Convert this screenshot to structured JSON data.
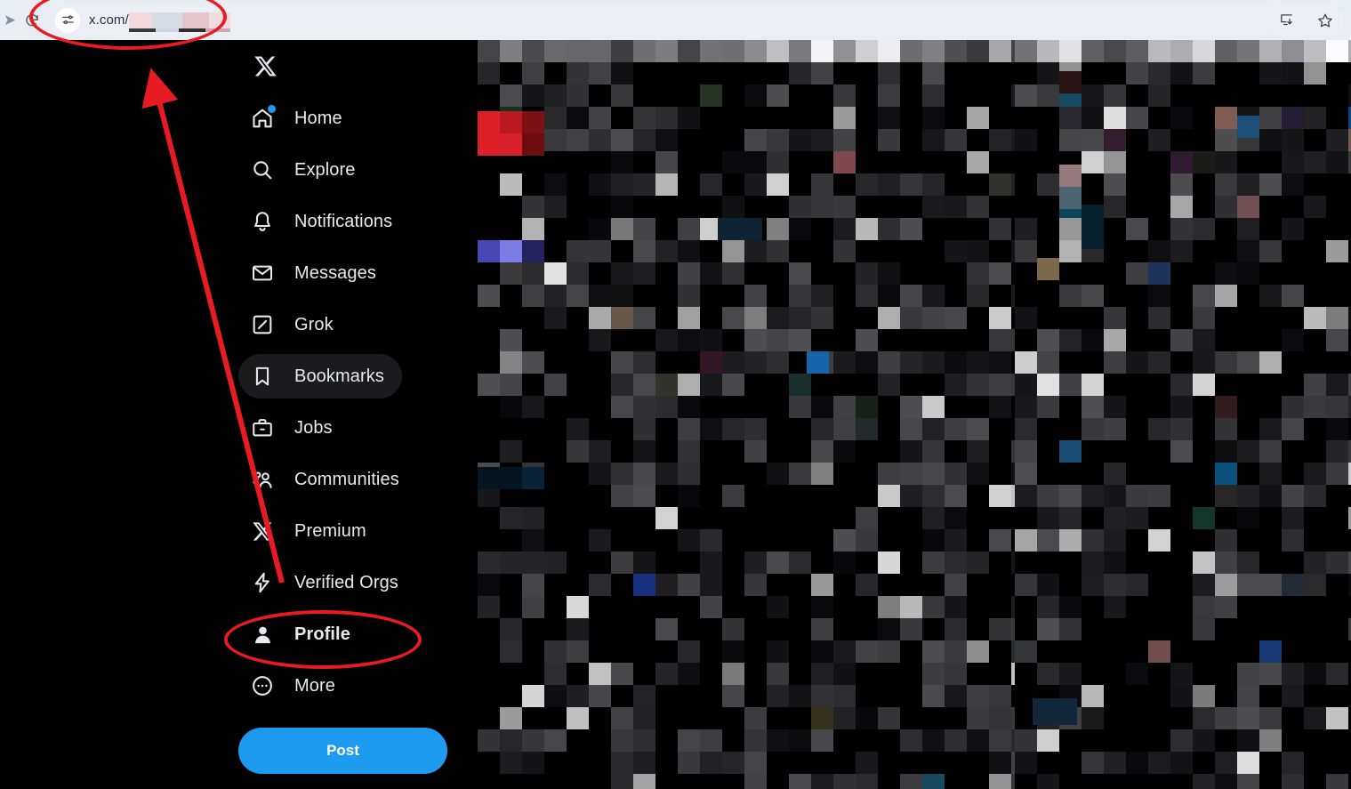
{
  "browser": {
    "forward_icon": "forward-arrow-icon",
    "reload_icon": "reload-icon",
    "site_settings_icon": "site-settings-sliders-icon",
    "url_text": "x.com/",
    "url_path_redacted": true,
    "install_app_icon": "install-app-icon",
    "bookmark_star_icon": "bookmark-star-icon"
  },
  "sidebar": {
    "logo": "x-logo-icon",
    "post_label": "Post",
    "items": [
      {
        "label": "Home",
        "icon": "home-icon",
        "badge_dot": true,
        "active": false,
        "pill": false
      },
      {
        "label": "Explore",
        "icon": "search-icon",
        "badge_dot": false,
        "active": false,
        "pill": false
      },
      {
        "label": "Notifications",
        "icon": "bell-icon",
        "badge_dot": false,
        "active": false,
        "pill": false
      },
      {
        "label": "Messages",
        "icon": "envelope-icon",
        "badge_dot": false,
        "active": false,
        "pill": false
      },
      {
        "label": "Grok",
        "icon": "grok-icon",
        "badge_dot": false,
        "active": false,
        "pill": false
      },
      {
        "label": "Bookmarks",
        "icon": "bookmark-icon",
        "badge_dot": false,
        "active": false,
        "pill": true
      },
      {
        "label": "Jobs",
        "icon": "briefcase-icon",
        "badge_dot": false,
        "active": false,
        "pill": false
      },
      {
        "label": "Communities",
        "icon": "communities-icon",
        "badge_dot": false,
        "active": false,
        "pill": false
      },
      {
        "label": "Premium",
        "icon": "x-premium-icon",
        "badge_dot": false,
        "active": false,
        "pill": false
      },
      {
        "label": "Verified Orgs",
        "icon": "lightning-bolt-icon",
        "badge_dot": false,
        "active": false,
        "pill": false
      },
      {
        "label": "Profile",
        "icon": "person-icon",
        "badge_dot": false,
        "active": true,
        "pill": false
      },
      {
        "label": "More",
        "icon": "more-circle-icon",
        "badge_dot": false,
        "active": false,
        "pill": false
      }
    ]
  },
  "content": {
    "censored": true,
    "note": "timeline and right rail are pixel-mosaic redacted"
  },
  "annotations": {
    "color": "#e81b23",
    "url_ellipse": {
      "name": "url-bar-highlight-ellipse"
    },
    "profile_ellipse": {
      "name": "profile-highlight-ellipse"
    },
    "arrow": {
      "name": "pointer-arrow",
      "from": "Verified Orgs area",
      "to": "url bar"
    }
  },
  "colors": {
    "accent_blue": "#1d9bf0",
    "annotation_red": "#e81b23",
    "app_background": "#000000",
    "browser_chrome": "#e9edf4",
    "pill_background": "#1b1b1d"
  }
}
